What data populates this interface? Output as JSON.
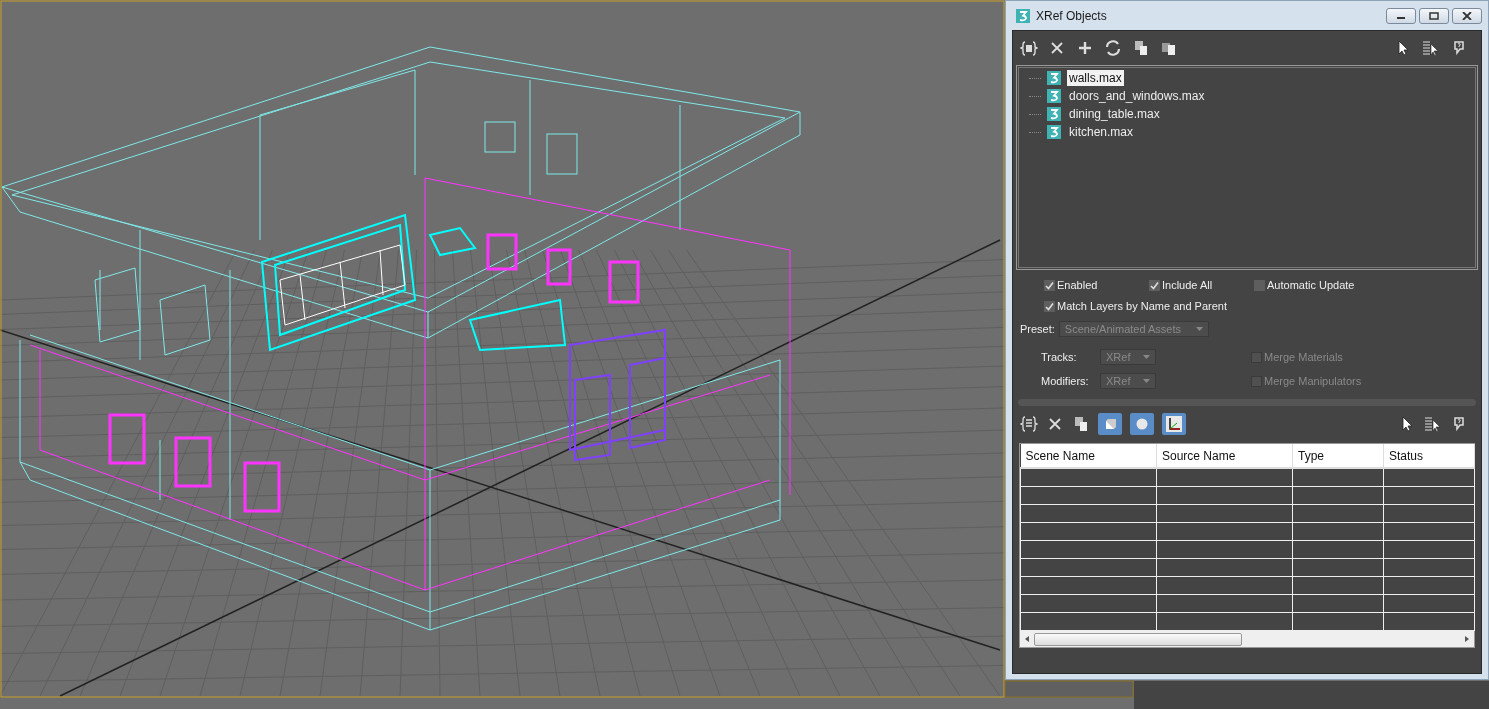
{
  "window": {
    "title": "XRef Objects"
  },
  "tree": {
    "items": [
      {
        "label": "walls.max",
        "selected": true
      },
      {
        "label": "doors_and_windows.max",
        "selected": false
      },
      {
        "label": "dining_table.max",
        "selected": false
      },
      {
        "label": "kitchen.max",
        "selected": false
      }
    ]
  },
  "options": {
    "checkboxes": [
      {
        "label": "Enabled",
        "checked": true,
        "disabled": false
      },
      {
        "label": "Include All",
        "checked": true,
        "disabled": false
      },
      {
        "label": "Automatic Update",
        "checked": false,
        "disabled": false
      },
      {
        "label": "Match Layers by Name and Parent",
        "checked": true,
        "disabled": false
      }
    ]
  },
  "preset": {
    "label": "Preset:",
    "value": "Scene/Animated Assets",
    "disabled": true
  },
  "tracks": {
    "label": "Tracks:",
    "value": "XRef",
    "disabled": true
  },
  "modifiers": {
    "label": "Modifiers:",
    "value": "XRef",
    "disabled": true
  },
  "merge": {
    "checkboxes": [
      {
        "label": "Merge Materials",
        "checked": false,
        "disabled": true
      },
      {
        "label": "Merge Manipulators",
        "checked": false,
        "disabled": true
      }
    ]
  },
  "bottom_toolbar": {
    "toggles": [
      {
        "selected": true
      },
      {
        "selected": true
      },
      {
        "selected": true
      }
    ]
  },
  "table": {
    "columns": [
      "Scene Name",
      "Source Name",
      "Type",
      "Status"
    ]
  }
}
